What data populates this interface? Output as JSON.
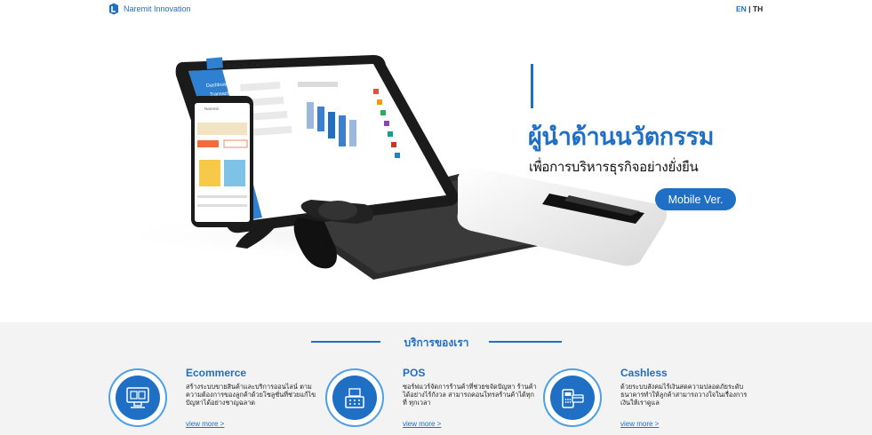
{
  "header": {
    "brand": "Naremit Innovation",
    "lang_en": "EN",
    "lang_sep": " | ",
    "lang_th": "TH"
  },
  "hero": {
    "headline": "ผู้นำด้านนวัตกรรม",
    "subhead": "เพื่อการบริหารธุรกิจอย่างยั่งยืน",
    "button": "Mobile Ver.",
    "tablet_title": "BACK-OFFICE",
    "tablet_menu": [
      "Dashboard",
      "Transactions",
      "Products",
      "Stored value",
      "Users",
      "Activity Log"
    ],
    "phone_label": "Naremit"
  },
  "services": {
    "title": "บริการของเรา",
    "items": [
      {
        "title": "Ecommerce",
        "desc": "สร้างระบบขายสินค้าและบริการออนไลน์ ตามความต้องการของลูกค้าด้วยโซลูชั่นที่ช่วยแก้ไขปัญหาได้อย่างชาญฉลาด",
        "link": "view more >",
        "icon": "ecommerce-icon"
      },
      {
        "title": "POS",
        "desc": "ซอร์ฟแวร์จัดการร้านค้าที่ช่วยขจัดปัญหา ร้านค้าได้อย่างไร้กังวล สามารถคอนโทรลร้านค้าได้ทุกที่ ทุกเวลา",
        "link": "view more >",
        "icon": "pos-icon"
      },
      {
        "title": "Cashless",
        "desc": "ด้วยระบบสังคมไร้เงินสดความปลอดภัยระดับธนาคารทำให้ลูกค้าสามารถวางใจในเรื่องการเงินให้เราดูแล",
        "link": "view more >",
        "icon": "cashless-icon"
      }
    ]
  },
  "colors": {
    "brand": "#1f6fc4",
    "section_bg": "#f3f3f3"
  }
}
